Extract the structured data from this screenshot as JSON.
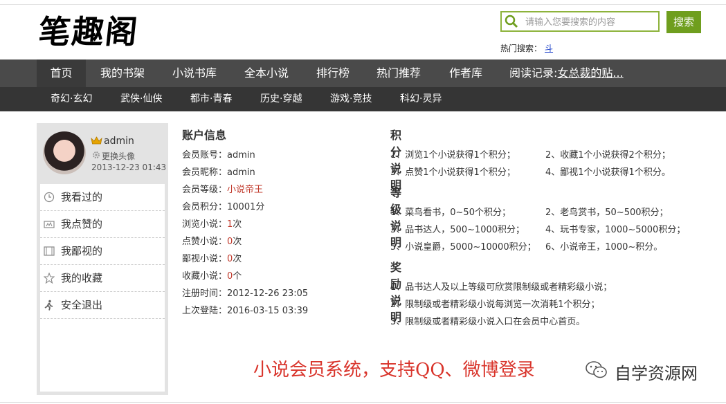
{
  "site": {
    "logo": "笔趣阁"
  },
  "search": {
    "placeholder": "请输入您要搜索的内容",
    "button": "搜索",
    "hot_label": "热门搜索：",
    "hot_keyword": "斗"
  },
  "nav": {
    "main": [
      "首页",
      "我的书架",
      "小说书库",
      "全本小说",
      "排行榜",
      "热门推荐",
      "作者库"
    ],
    "reading_label": "阅读记录:",
    "reading_link": "女总裁的贴...",
    "categories": [
      "奇幻·玄幻",
      "武侠·仙侠",
      "都市·青春",
      "历史·穿越",
      "游戏·竞技",
      "科幻·灵异"
    ]
  },
  "profile": {
    "username": "admin",
    "change_avatar": "更换头像",
    "date": "2013-12-23 01:43"
  },
  "sidebar_menu": [
    {
      "label": "我看过的",
      "icon": "clock-icon"
    },
    {
      "label": "我点赞的",
      "icon": "thumb-icon"
    },
    {
      "label": "我鄙视的",
      "icon": "film-icon"
    },
    {
      "label": "我的收藏",
      "icon": "star-icon"
    },
    {
      "label": "安全退出",
      "icon": "running-man-icon"
    }
  ],
  "account": {
    "title": "账户信息",
    "rows": [
      {
        "label": "会员账号：",
        "value": "admin"
      },
      {
        "label": "会员昵称：",
        "value": "admin"
      },
      {
        "label": "会员等级：",
        "value": "小说帝王"
      },
      {
        "label": "会员积分：",
        "value": "10001分"
      },
      {
        "label": "浏览小说：",
        "value": "1",
        "unit": "次"
      },
      {
        "label": "点赞小说：",
        "value": "0",
        "unit": "次"
      },
      {
        "label": "鄙视小说：",
        "value": "0",
        "unit": "次"
      },
      {
        "label": "收藏小说：",
        "value": "0",
        "unit": "个"
      },
      {
        "label": "注册时间：",
        "value": "2012-12-26 23:05"
      },
      {
        "label": "上次登陆：",
        "value": "2016-03-15 03:39"
      }
    ]
  },
  "points": {
    "title": "积分说明",
    "items": [
      "1、浏览1个小说获得1个积分；",
      "2、收藏1个小说获得2个积分；",
      "3、点赞1个小说获得1个积分；",
      "4、鄙视1个小说获得1个积分。"
    ]
  },
  "levels": {
    "title": "等级说明",
    "items": [
      "1、菜鸟看书，0~50个积分；",
      "2、老鸟赏书，50~500积分；",
      "3、品书达人，500~1000积分；",
      "4、玩书专家，1000~5000积分；",
      "5、小说皇爵，5000~10000积分；",
      "6、小说帝王，1000~积分。"
    ]
  },
  "rewards": {
    "title": "奖励说明",
    "items": [
      "1、品书达人及以上等级可欣赏限制级或者精彩级小说；",
      "2、限制级或者精彩级小说每浏览一次消耗1个积分；",
      "3、限制级或者精彩级小说入口在会员中心首页。"
    ]
  },
  "banner": "小说会员系统，支持QQ、微博登录",
  "watermark": "自学资源网",
  "colors": {
    "accent_green": "#6f9e1e",
    "nav_dark": "#4a4a4a",
    "subnav": "#353535",
    "red": "#d9342b"
  }
}
